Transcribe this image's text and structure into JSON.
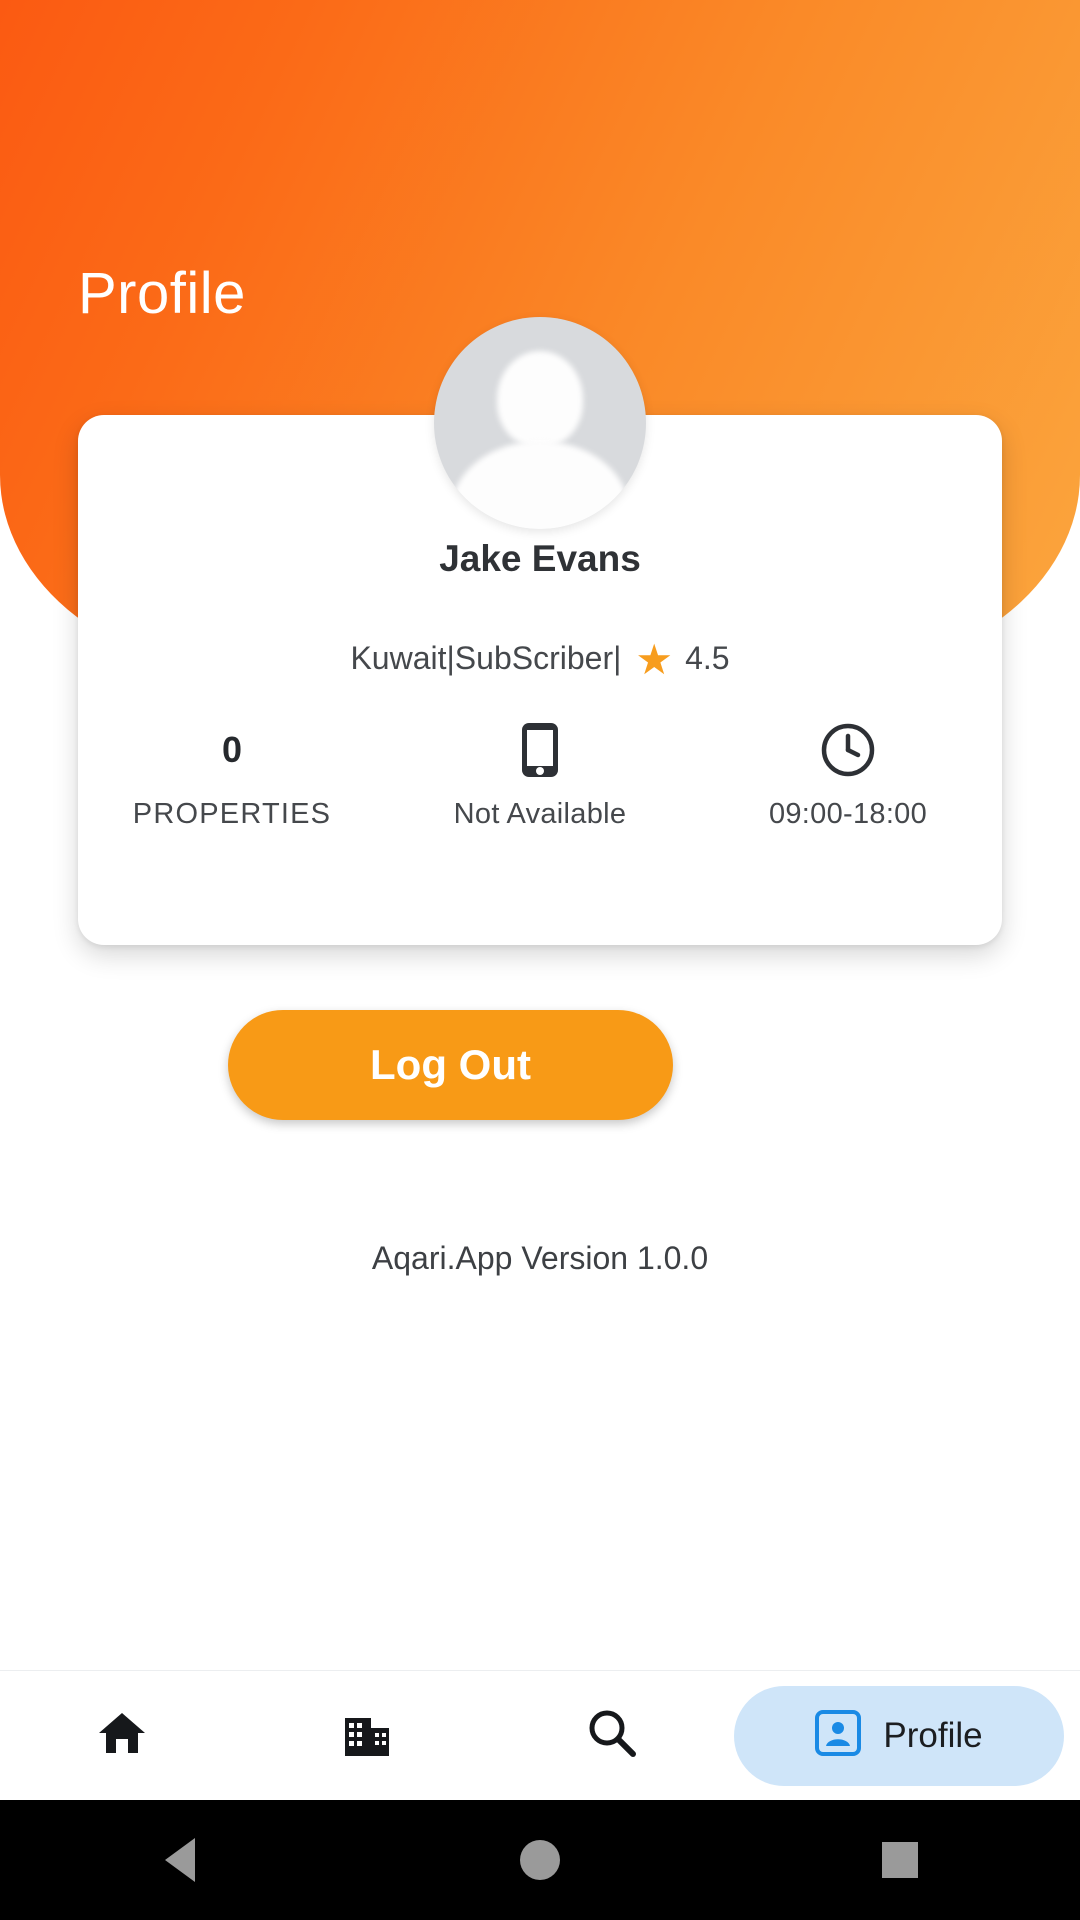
{
  "header": {
    "title": "Profile",
    "gradient_from": "#fb5a12",
    "gradient_to": "#fba63e"
  },
  "profile_card": {
    "avatar_icon": "person-avatar-placeholder",
    "name": "Jake Evans",
    "meta": {
      "location": "Kuwait",
      "separator_1": " | ",
      "role": "SubScriber",
      "separator_2": " | ",
      "star_icon": "star-icon",
      "star_color": "#f79d1e",
      "rating": "4.5"
    },
    "stats": [
      {
        "value": "0",
        "icon": "",
        "label": "PROPERTIES"
      },
      {
        "value": "",
        "icon": "phone-icon",
        "label": "Not Available"
      },
      {
        "value": "",
        "icon": "clock-icon",
        "label": "09:00-18:00"
      }
    ]
  },
  "logout_button": {
    "label": "Log Out",
    "color": "#f89a16"
  },
  "version_text": "Aqari.App Version 1.0.0",
  "bottom_nav": {
    "items": [
      {
        "label": "",
        "icon": "home-icon",
        "active": false
      },
      {
        "label": "",
        "icon": "building-icon",
        "active": false
      },
      {
        "label": "",
        "icon": "search-icon",
        "active": false
      },
      {
        "label": "Profile",
        "icon": "profile-icon",
        "active": true
      }
    ],
    "active_pill_color": "#cfe5f9",
    "active_icon_color": "#1a8ae5"
  },
  "system_nav": {
    "back": "back-triangle-icon",
    "home": "home-circle-icon",
    "recents": "recents-square-icon"
  }
}
